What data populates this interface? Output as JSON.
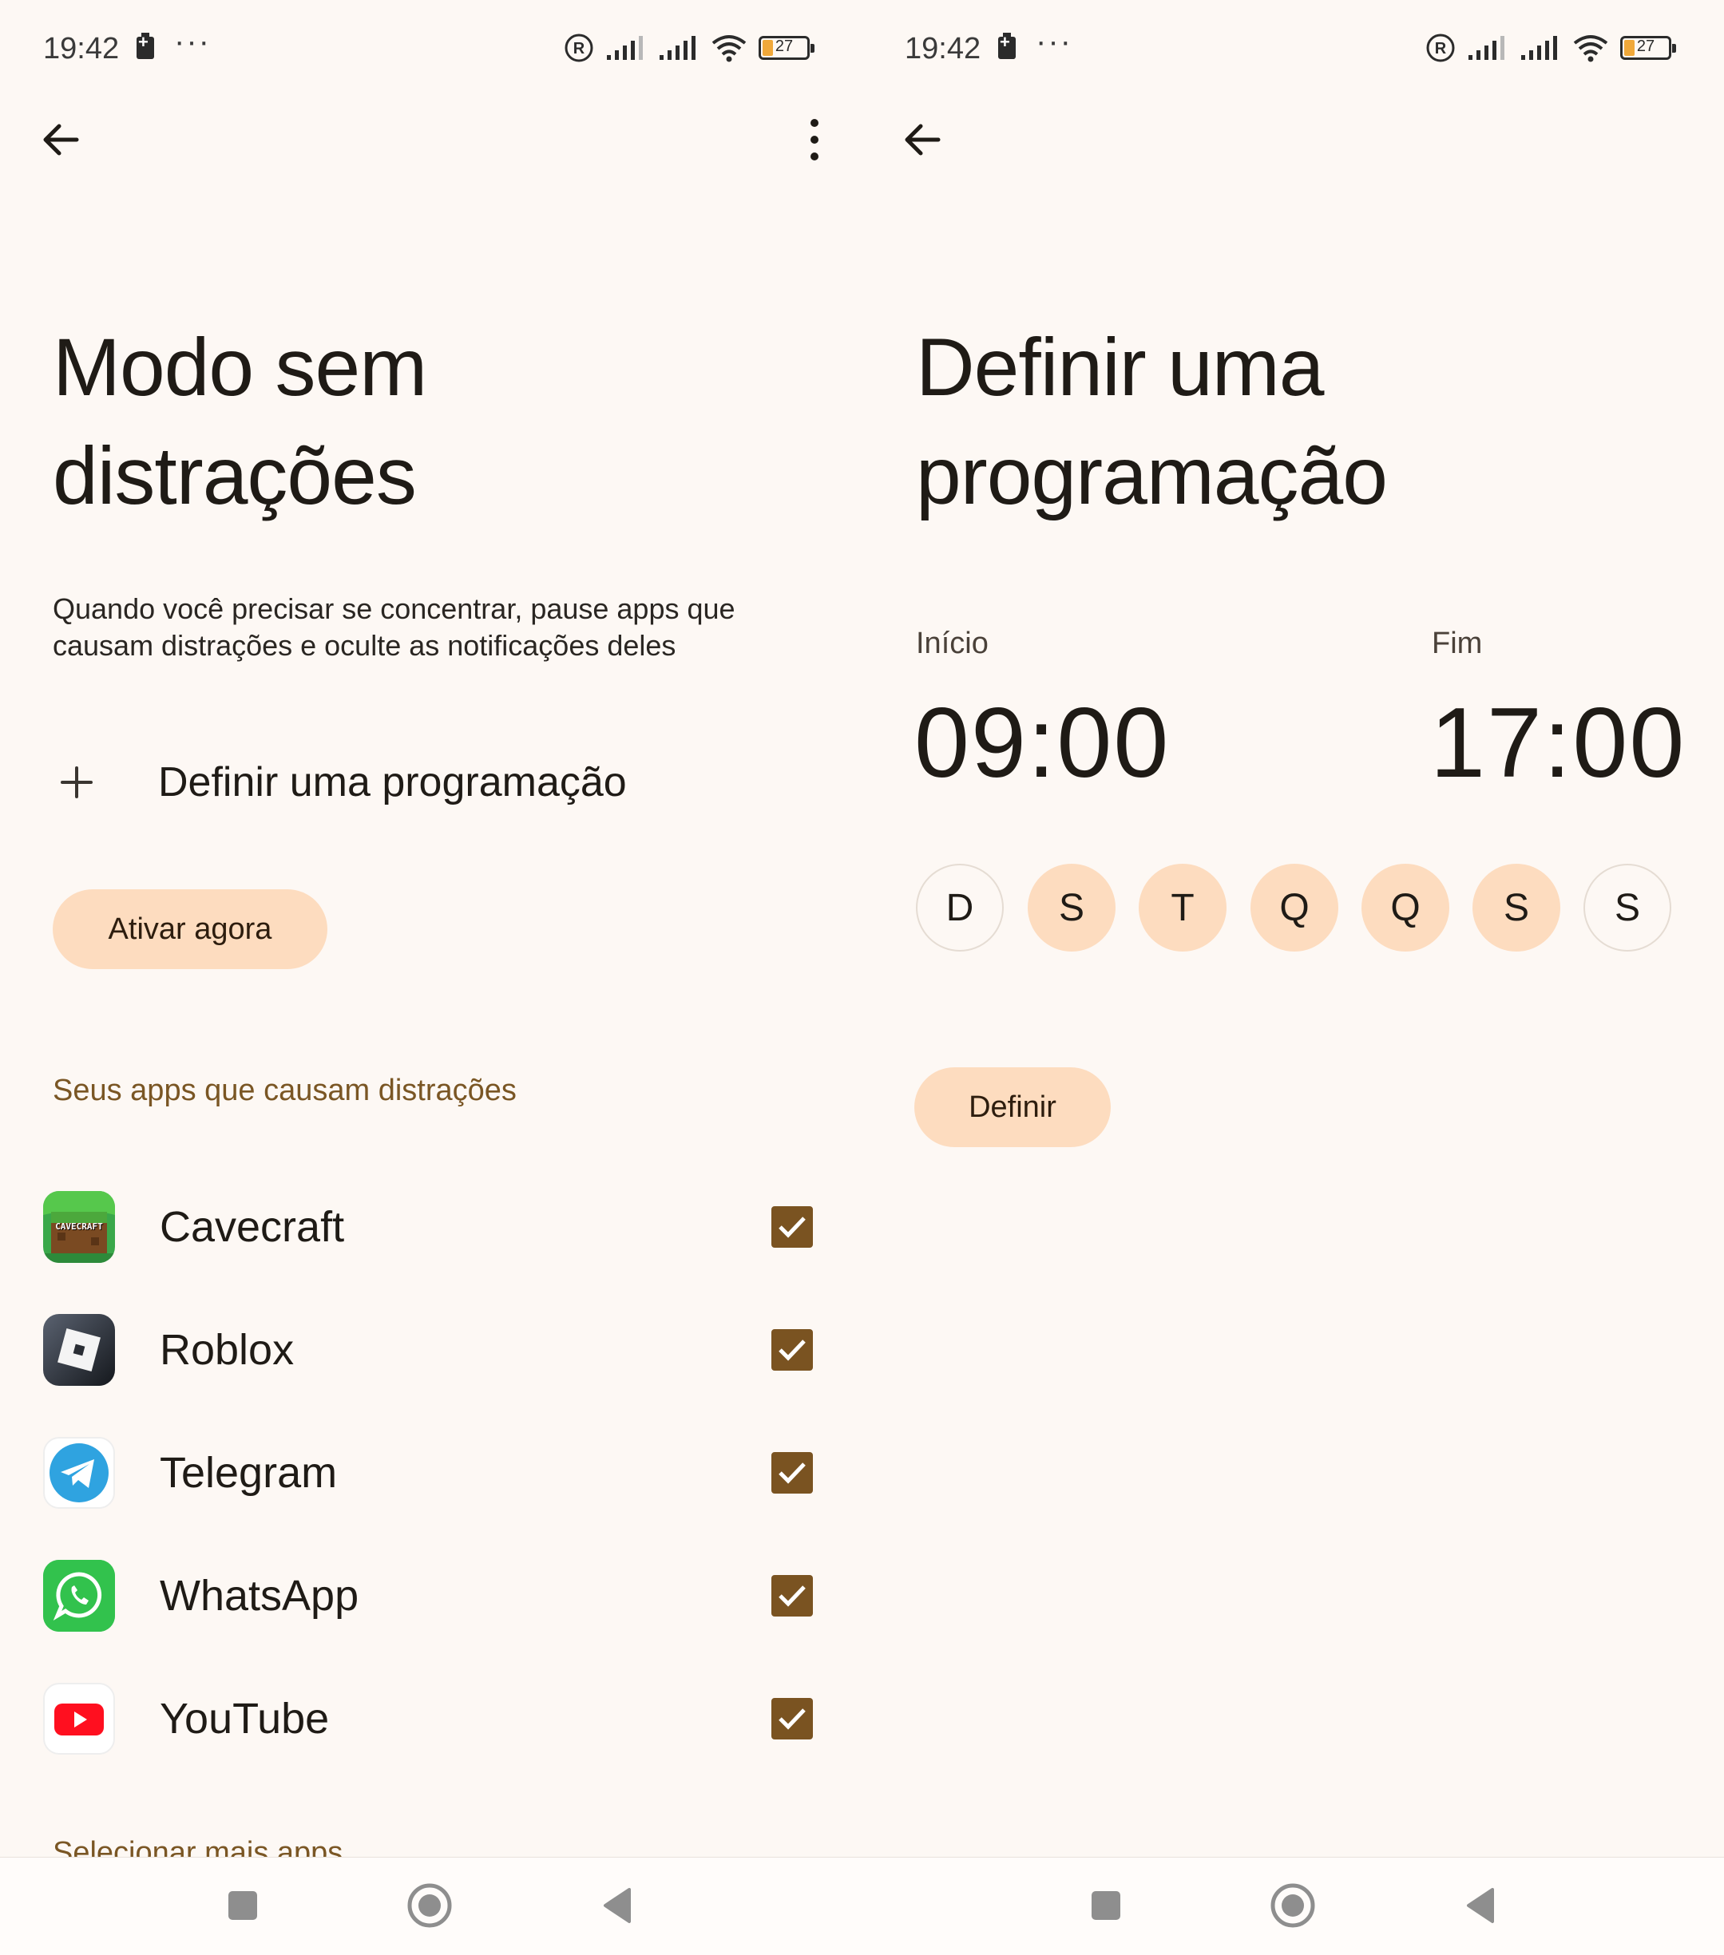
{
  "status_bar": {
    "time": "19:42",
    "battery_level": "27"
  },
  "left_screen": {
    "title": "Modo sem distrações",
    "description": "Quando você precisar se concentrar, pause apps que causam distrações e oculte as notificações deles",
    "schedule_link": "Definir uma programação",
    "activate_button": "Ativar agora",
    "section_title": "Seus apps que causam distrações",
    "apps": [
      {
        "name": "Cavecraft",
        "icon": "cavecraft-icon",
        "checked": true
      },
      {
        "name": "Roblox",
        "icon": "roblox-icon",
        "checked": true
      },
      {
        "name": "Telegram",
        "icon": "telegram-icon",
        "checked": true
      },
      {
        "name": "WhatsApp",
        "icon": "whatsapp-icon",
        "checked": true
      },
      {
        "name": "YouTube",
        "icon": "youtube-icon",
        "checked": true
      }
    ],
    "cavecraft_logo_text": "CAVECRAFT",
    "more_apps": "Selecionar mais apps"
  },
  "right_screen": {
    "title": "Definir uma programação",
    "start_label": "Início",
    "start_time": "09:00",
    "end_label": "Fim",
    "end_time": "17:00",
    "days": [
      {
        "label": "D",
        "selected": false
      },
      {
        "label": "S",
        "selected": true
      },
      {
        "label": "T",
        "selected": true
      },
      {
        "label": "Q",
        "selected": true
      },
      {
        "label": "Q",
        "selected": true
      },
      {
        "label": "S",
        "selected": true
      },
      {
        "label": "S",
        "selected": false
      }
    ],
    "set_button": "Definir"
  },
  "colors": {
    "background": "#fdf8f4",
    "accent_pill": "#fddcbf",
    "section_title": "#7a5624",
    "checkbox": "#7a5321"
  }
}
